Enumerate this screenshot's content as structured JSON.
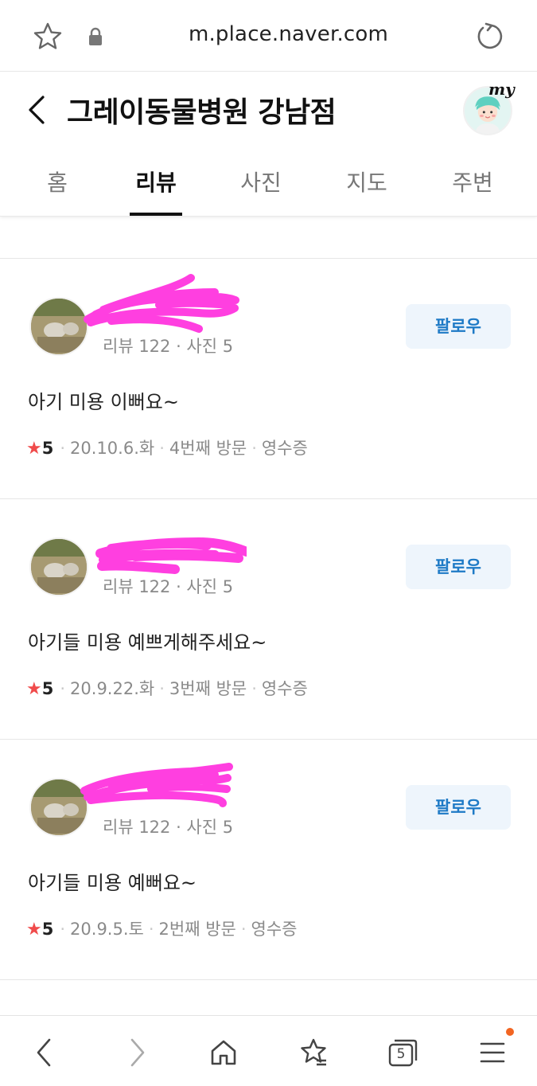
{
  "browser": {
    "url": "m.place.naver.com"
  },
  "place": {
    "title": "그레이동물병원 강남점",
    "my_label": "my"
  },
  "tabs": [
    {
      "label": "홈",
      "active": false
    },
    {
      "label": "리뷰",
      "active": true
    },
    {
      "label": "사진",
      "active": false
    },
    {
      "label": "지도",
      "active": false
    },
    {
      "label": "주변",
      "active": false
    }
  ],
  "reviews": [
    {
      "user_meta": "리뷰 122 · 사진 5",
      "follow_label": "팔로우",
      "text": "아기 미용 이뻐요~",
      "rating": "5",
      "date": "20.10.6.화",
      "visit": "4번째 방문",
      "receipt": "영수증"
    },
    {
      "user_meta": "리뷰 122 · 사진 5",
      "follow_label": "팔로우",
      "text": "아기들 미용 예쁘게해주세요~",
      "rating": "5",
      "date": "20.9.22.화",
      "visit": "3번째 방문",
      "receipt": "영수증"
    },
    {
      "user_meta": "리뷰 122 · 사진 5",
      "follow_label": "팔로우",
      "text": "아기들 미용 예뻐요~",
      "rating": "5",
      "date": "20.9.5.토",
      "visit": "2번째 방문",
      "receipt": "영수증"
    }
  ],
  "toolbar": {
    "tab_count": "5"
  },
  "colors": {
    "accent": "#1e7ac6",
    "star": "#f04b4b",
    "scribble": "#ff3fe0",
    "notification": "#f26522"
  }
}
